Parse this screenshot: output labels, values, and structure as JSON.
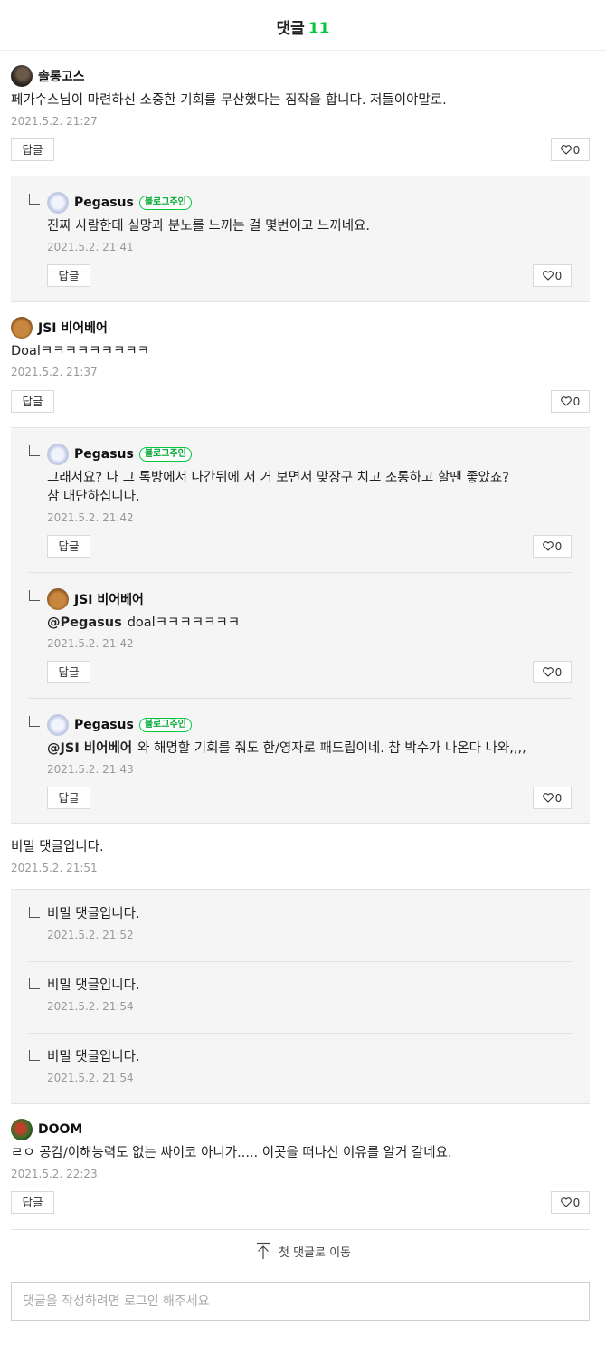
{
  "header": {
    "title": "댓글",
    "count": "11"
  },
  "labels": {
    "reply": "답글",
    "owner_badge": "블로그주인",
    "goto_first": "첫 댓글로 이동",
    "input_placeholder": "댓글을 작성하려면 로그인 해주세요"
  },
  "comments": [
    {
      "author": "솔롱고스",
      "text": "페가수스님이 마련하신 소중한 기회를 무산했다는 짐작을 합니다. 저들이야말로.",
      "date": "2021.5.2. 21:27",
      "likes": "0",
      "replies": [
        {
          "author": "Pegasus",
          "owner": true,
          "text": "진짜 사람한테 실망과 분노를 느끼는 걸 몇번이고 느끼네요.",
          "date": "2021.5.2. 21:41",
          "likes": "0"
        }
      ]
    },
    {
      "author": "JSI 비어베어",
      "text": "Doalㅋㅋㅋㅋㅋㅋㅋㅋㅋ",
      "date": "2021.5.2. 21:37",
      "likes": "0",
      "replies": [
        {
          "author": "Pegasus",
          "owner": true,
          "text_line1": "그래서요? 나 그 톡방에서 나간뒤에 저 거 보면서 맞장구 치고 조롱하고 할땐 좋았죠?",
          "text_line2": "참 대단하십니다.",
          "date": "2021.5.2. 21:42",
          "likes": "0"
        },
        {
          "author": "JSI 비어베어",
          "owner": false,
          "mention": "@Pegasus",
          "text": "doalㅋㅋㅋㅋㅋㅋㅋ",
          "date": "2021.5.2. 21:42",
          "likes": "0"
        },
        {
          "author": "Pegasus",
          "owner": true,
          "mention": "@JSI 비어베어",
          "text": "와 해명할 기회를 줘도 한/영자로 패드립이네. 참 박수가 나온다 나와,,,,",
          "date": "2021.5.2. 21:43",
          "likes": "0"
        }
      ]
    },
    {
      "text": "비밀 댓글입니다.",
      "date": "2021.5.2. 21:51",
      "replies": [
        {
          "text": "비밀 댓글입니다.",
          "date": "2021.5.2. 21:52"
        },
        {
          "text": "비밀 댓글입니다.",
          "date": "2021.5.2. 21:54"
        },
        {
          "text": "비밀 댓글입니다.",
          "date": "2021.5.2. 21:54"
        }
      ]
    },
    {
      "author": "DOOM",
      "text": "ㄹㅇ 공감/이해능력도 없는 싸이코 아니가..... 이곳을 떠나신 이유를 알거 갈네요.",
      "date": "2021.5.2. 22:23",
      "likes": "0"
    }
  ]
}
